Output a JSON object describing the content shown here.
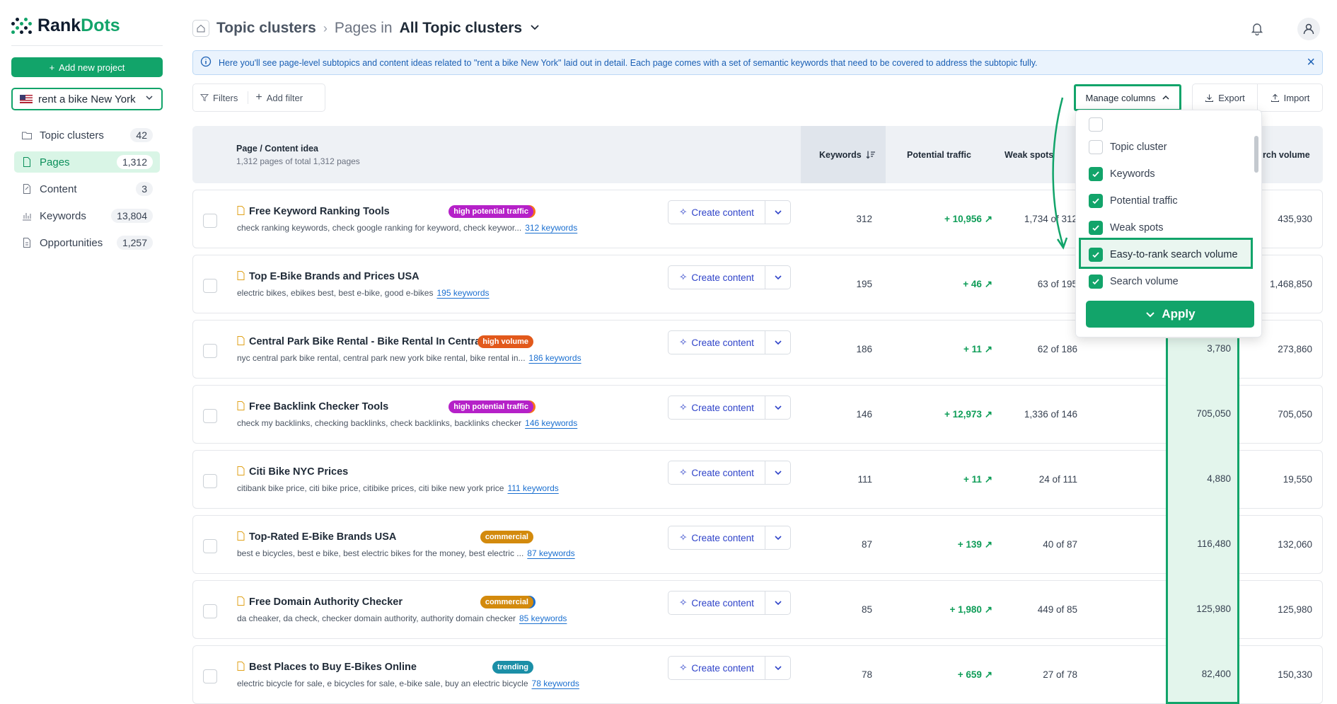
{
  "app": {
    "logo_rank": "Rank",
    "logo_dots": "Dots",
    "brand_color": "#12a46a"
  },
  "sidebar": {
    "add_project": "Add new project",
    "project": "rent a bike New York",
    "items": [
      {
        "label": "Topic clusters",
        "count": "42",
        "icon": "folder-icon"
      },
      {
        "label": "Pages",
        "count": "1,312",
        "icon": "page-icon"
      },
      {
        "label": "Content",
        "count": "3",
        "icon": "content-icon"
      },
      {
        "label": "Keywords",
        "count": "13,804",
        "icon": "bar-chart-icon"
      },
      {
        "label": "Opportunities",
        "count": "1,257",
        "icon": "opportunity-icon"
      }
    ]
  },
  "header": {
    "crumb1": "Topic clusters",
    "crumb2_prefix": "Pages in",
    "crumb2_value": "All Topic clusters"
  },
  "info": {
    "text": "Here you'll see page-level subtopics and content ideas related to \"rent a bike New York\" laid out in detail. Each page comes with a set of semantic keywords that need to be covered to address the subtopic fully."
  },
  "toolbar": {
    "filters": "Filters",
    "add_filter": "Add filter",
    "manage_columns": "Manage columns",
    "export": "Export",
    "import": "Import"
  },
  "table": {
    "col_page": "Page / Content idea",
    "col_page_sub": "1,312 pages of total 1,312 pages",
    "col_keywords": "Keywords",
    "col_traffic": "Potential traffic",
    "col_weak": "Weak spots",
    "col_sv": "rch volume",
    "create_label": "Create content",
    "rows": [
      {
        "title": "Free Keyword Ranking Tools",
        "badge": "high potential traffic",
        "badge_type": "hpt",
        "kws": "check ranking keywords, check google ranking for keyword, check keywor...",
        "link": "312 keywords",
        "kw": "312",
        "pt": "+ 10,956",
        "ws": "1,734 of 312",
        "er": "",
        "sv": "435,930"
      },
      {
        "title": "Top E-Bike Brands and Prices USA",
        "badge": "",
        "badge_type": "",
        "kws": "electric bikes, ebikes best, best e-bike, good e-bikes",
        "link": "195 keywords",
        "kw": "195",
        "pt": "+ 46",
        "ws": "63 of 195",
        "er": "",
        "sv": "1,468,850"
      },
      {
        "title": "Central Park Bike Rental - Bike Rental In Central Park",
        "badge": "high volume",
        "badge_type": "hv",
        "kws": "nyc central park bike rental, central park new york bike rental, bike rental in...",
        "link": "186 keywords",
        "kw": "186",
        "pt": "+ 11",
        "ws": "62 of 186",
        "er": "3,780",
        "sv": "273,860"
      },
      {
        "title": "Free Backlink Checker Tools",
        "badge": "high potential traffic",
        "badge_type": "hpt",
        "kws": "check my backlinks, checking backlinks, check backlinks, backlinks checker",
        "link": "146 keywords",
        "kw": "146",
        "pt": "+ 12,973",
        "ws": "1,336 of 146",
        "er": "705,050",
        "sv": "705,050"
      },
      {
        "title": "Citi Bike NYC Prices",
        "badge": "",
        "badge_type": "",
        "kws": "citibank bike price, citi bike price, citibike prices, citi bike new york price",
        "link": "111 keywords",
        "kw": "111",
        "pt": "+ 11",
        "ws": "24 of 111",
        "er": "4,880",
        "sv": "19,550"
      },
      {
        "title": "Top-Rated E-Bike Brands USA",
        "badge": "commercial",
        "badge_type": "com",
        "kws": "best e bicycles, best e bike, best electric bikes for the money, best electric ...",
        "link": "87 keywords",
        "kw": "87",
        "pt": "+ 139",
        "ws": "40 of 87",
        "er": "116,480",
        "sv": "132,060"
      },
      {
        "title": "Free Domain Authority Checker",
        "badge": "commercial",
        "badge_type": "com2",
        "kws": "da cheaker, da check, checker domain authority, authority domain checker",
        "link": "85 keywords",
        "kw": "85",
        "pt": "+ 1,980",
        "ws": "449 of 85",
        "er": "125,980",
        "sv": "125,980"
      },
      {
        "title": "Best Places to Buy E-Bikes Online",
        "badge": "trending",
        "badge_type": "tr",
        "kws": "electric bicycle for sale, e bicycles for sale, e-bike sale, buy an electric bicycle",
        "link": "78 keywords",
        "kw": "78",
        "pt": "+ 659",
        "ws": "27 of 78",
        "er": "82,400",
        "sv": "150,330"
      }
    ]
  },
  "manage_dropdown": {
    "items": [
      {
        "label": "",
        "checked": false
      },
      {
        "label": "Topic cluster",
        "checked": false
      },
      {
        "label": "Keywords",
        "checked": true
      },
      {
        "label": "Potential traffic",
        "checked": true
      },
      {
        "label": "Weak spots",
        "checked": true
      },
      {
        "label": "Easy-to-rank search volume",
        "checked": true
      },
      {
        "label": "Search volume",
        "checked": true
      }
    ],
    "apply": "Apply"
  }
}
